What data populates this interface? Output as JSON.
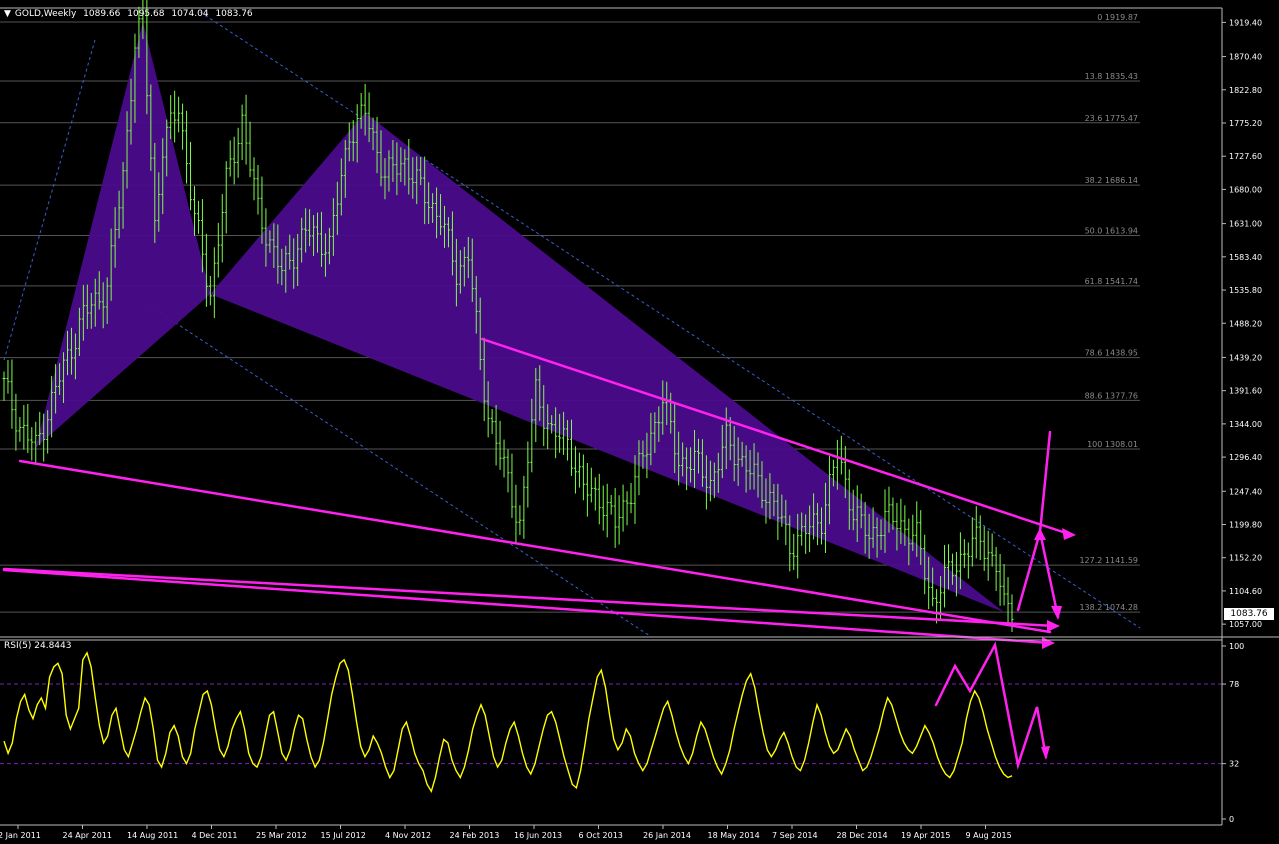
{
  "header": {
    "symbol": "GOLD,Weekly",
    "open": "1089.66",
    "high": "1095.68",
    "low": "1074.04",
    "close": "1083.76"
  },
  "rsi_header": {
    "label": "RSI(5)",
    "value": "24.8443"
  },
  "current_price": "1083.76",
  "colors": {
    "background": "#000000",
    "candle": "#7CFC4A",
    "pattern_fill": "#4B0B8C",
    "trendline": "#FF22EE",
    "rsi_line": "#FFFF00",
    "level_line": "#555555",
    "grid_text": "#C0C0C0"
  },
  "chart_data": [
    {
      "type": "line",
      "name": "price",
      "yaxis_ticks": [
        "1919.40",
        "1870.40",
        "1822.80",
        "1775.20",
        "1727.60",
        "1680.00",
        "1631.00",
        "1583.40",
        "1535.80",
        "1488.20",
        "1439.20",
        "1391.60",
        "1344.00",
        "1296.40",
        "1247.40",
        "1199.80",
        "1152.20",
        "1104.60",
        "1057.00"
      ],
      "xaxis_ticks": [
        "2 Jan 2011",
        "24 Apr 2011",
        "14 Aug 2011",
        "4 Dec 2011",
        "25 Mar 2012",
        "15 Jul 2012",
        "4 Nov 2012",
        "24 Feb 2013",
        "16 Jun 2013",
        "6 Oct 2013",
        "26 Jan 2014",
        "18 May 2014",
        "7 Sep 2014",
        "28 Dec 2014",
        "19 Apr 2015",
        "9 Aug 2015"
      ],
      "ylim": [
        1040,
        1940
      ],
      "fib_levels": [
        {
          "label": "0 1919.87",
          "value": 1919.87
        },
        {
          "label": "13.8 1835.43",
          "value": 1835.43
        },
        {
          "label": "23.6 1775.47",
          "value": 1775.47
        },
        {
          "label": "38.2 1686.14",
          "value": 1686.14
        },
        {
          "label": "50.0 1613.94",
          "value": 1613.94
        },
        {
          "label": "61.8 1541.74",
          "value": 1541.74
        },
        {
          "label": "78.6 1438.95",
          "value": 1438.95
        },
        {
          "label": "88.6 1377.76",
          "value": 1377.76
        },
        {
          "label": "100 1308.01",
          "value": 1308.01
        },
        {
          "label": "127.2 1141.59",
          "value": 1141.59
        },
        {
          "label": "138.2 1074.28",
          "value": 1074.28
        }
      ],
      "weeks": 255,
      "anchors": [
        {
          "week": 0,
          "value": 1400
        },
        {
          "week": 4,
          "value": 1340
        },
        {
          "week": 8,
          "value": 1310
        },
        {
          "week": 14,
          "value": 1410
        },
        {
          "week": 20,
          "value": 1500
        },
        {
          "week": 26,
          "value": 1540
        },
        {
          "week": 30,
          "value": 1700
        },
        {
          "week": 33,
          "value": 1890
        },
        {
          "week": 35,
          "value": 1920
        },
        {
          "week": 38,
          "value": 1630
        },
        {
          "week": 40,
          "value": 1740
        },
        {
          "week": 44,
          "value": 1800
        },
        {
          "week": 48,
          "value": 1640
        },
        {
          "week": 52,
          "value": 1530
        },
        {
          "week": 56,
          "value": 1690
        },
        {
          "week": 60,
          "value": 1780
        },
        {
          "week": 64,
          "value": 1650
        },
        {
          "week": 70,
          "value": 1560
        },
        {
          "week": 76,
          "value": 1620
        },
        {
          "week": 82,
          "value": 1600
        },
        {
          "week": 87,
          "value": 1760
        },
        {
          "week": 91,
          "value": 1790
        },
        {
          "week": 96,
          "value": 1700
        },
        {
          "week": 101,
          "value": 1720
        },
        {
          "week": 106,
          "value": 1670
        },
        {
          "week": 110,
          "value": 1640
        },
        {
          "week": 114,
          "value": 1560
        },
        {
          "week": 117,
          "value": 1590
        },
        {
          "week": 120,
          "value": 1430
        },
        {
          "week": 122,
          "value": 1360
        },
        {
          "week": 126,
          "value": 1280
        },
        {
          "week": 130,
          "value": 1200
        },
        {
          "week": 134,
          "value": 1390
        },
        {
          "week": 138,
          "value": 1330
        },
        {
          "week": 142,
          "value": 1320
        },
        {
          "week": 146,
          "value": 1250
        },
        {
          "week": 150,
          "value": 1240
        },
        {
          "week": 154,
          "value": 1200
        },
        {
          "week": 158,
          "value": 1250
        },
        {
          "week": 162,
          "value": 1310
        },
        {
          "week": 166,
          "value": 1380
        },
        {
          "week": 170,
          "value": 1290
        },
        {
          "week": 174,
          "value": 1290
        },
        {
          "week": 178,
          "value": 1260
        },
        {
          "week": 182,
          "value": 1320
        },
        {
          "week": 186,
          "value": 1290
        },
        {
          "week": 190,
          "value": 1260
        },
        {
          "week": 194,
          "value": 1230
        },
        {
          "week": 198,
          "value": 1170
        },
        {
          "week": 202,
          "value": 1190
        },
        {
          "week": 206,
          "value": 1210
        },
        {
          "week": 210,
          "value": 1300
        },
        {
          "week": 214,
          "value": 1220
        },
        {
          "week": 218,
          "value": 1180
        },
        {
          "week": 222,
          "value": 1210
        },
        {
          "week": 226,
          "value": 1200
        },
        {
          "week": 230,
          "value": 1180
        },
        {
          "week": 234,
          "value": 1090
        },
        {
          "week": 238,
          "value": 1130
        },
        {
          "week": 242,
          "value": 1160
        },
        {
          "week": 246,
          "value": 1180
        },
        {
          "week": 250,
          "value": 1140
        },
        {
          "week": 252,
          "value": 1080
        },
        {
          "week": 254,
          "value": 1084
        }
      ]
    },
    {
      "type": "line",
      "name": "RSI(5)",
      "yaxis_ticks": [
        "100",
        "78",
        "32",
        "0"
      ],
      "levels": [
        78,
        32
      ],
      "ylim": [
        0,
        100
      ],
      "samples": [
        45,
        38,
        44,
        58,
        68,
        72,
        63,
        58,
        66,
        70,
        64,
        82,
        88,
        90,
        84,
        60,
        52,
        58,
        64,
        92,
        96,
        88,
        70,
        54,
        44,
        48,
        60,
        64,
        52,
        40,
        36,
        44,
        52,
        62,
        70,
        66,
        52,
        34,
        30,
        38,
        50,
        54,
        48,
        36,
        32,
        38,
        52,
        62,
        72,
        74,
        66,
        52,
        40,
        36,
        42,
        52,
        58,
        62,
        52,
        38,
        32,
        30,
        36,
        48,
        60,
        62,
        50,
        38,
        34,
        40,
        52,
        60,
        58,
        46,
        36,
        30,
        34,
        44,
        58,
        72,
        82,
        90,
        92,
        86,
        72,
        56,
        42,
        36,
        40,
        48,
        44,
        38,
        30,
        24,
        28,
        40,
        52,
        56,
        48,
        38,
        32,
        28,
        20,
        16,
        24,
        36,
        46,
        44,
        34,
        28,
        24,
        30,
        40,
        52,
        60,
        66,
        60,
        48,
        36,
        30,
        34,
        44,
        52,
        56,
        48,
        38,
        30,
        26,
        32,
        42,
        52,
        60,
        62,
        56,
        46,
        36,
        28,
        20,
        18,
        28,
        42,
        58,
        70,
        82,
        86,
        76,
        60,
        46,
        40,
        44,
        52,
        48,
        38,
        32,
        28,
        32,
        40,
        48,
        56,
        64,
        68,
        60,
        50,
        42,
        36,
        32,
        38,
        48,
        56,
        52,
        44,
        36,
        30,
        26,
        32,
        40,
        52,
        62,
        72,
        80,
        84,
        76,
        62,
        50,
        40,
        36,
        40,
        46,
        50,
        44,
        36,
        30,
        28,
        34,
        44,
        56,
        66,
        60,
        50,
        42,
        38,
        40,
        46,
        52,
        48,
        40,
        34,
        28,
        30,
        36,
        44,
        52,
        62,
        70,
        66,
        58,
        50,
        44,
        40,
        38,
        42,
        48,
        54,
        50,
        44,
        36,
        30,
        26,
        24,
        28,
        36,
        44,
        58,
        68,
        74,
        70,
        62,
        52,
        44,
        36,
        30,
        26,
        24,
        25
      ]
    }
  ]
}
